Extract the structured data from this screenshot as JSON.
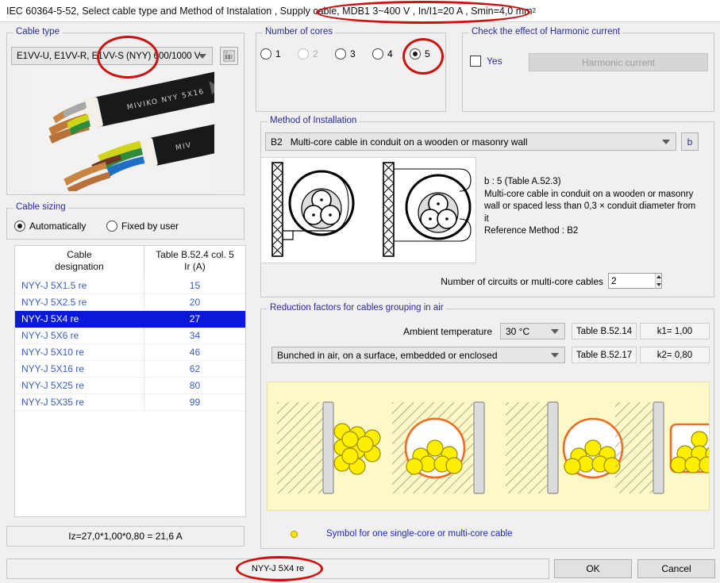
{
  "window": {
    "title_prefix": "IEC 60364-5-52, Select cable type and Method of Instalation , Supply cable, MDB1 3~400 V , In/I1=20 A , Smin=4,0 mm",
    "title_sup": "2"
  },
  "cable_type": {
    "group_label": "Cable type",
    "selected": "E1VV-U, E1VV-R, E1VV-S  (NYY)  600/1000 V",
    "table_icon": "table-icon",
    "photo_text": "MIVIKO NYY 5X16",
    "photo_text_2": "MIV"
  },
  "cable_sizing": {
    "group_label": "Cable sizing",
    "mode_auto": "Automatically",
    "mode_fixed": "Fixed by user",
    "mode_selected": "Automatically",
    "columns": [
      "Cable\ndesignation",
      "Table B.52.4 col. 5\nIr (A)"
    ],
    "col1_line1": "Cable",
    "col1_line2": "designation",
    "col2_line1": "Table B.52.4 col. 5",
    "col2_line2": "Ir (A)",
    "rows": [
      {
        "designation": "NYY-J 5X1.5 re",
        "ir": "15",
        "selected": false
      },
      {
        "designation": "NYY-J 5X2.5 re",
        "ir": "20",
        "selected": false
      },
      {
        "designation": "NYY-J 5X4 re",
        "ir": "27",
        "selected": true
      },
      {
        "designation": "NYY-J 5X6 re",
        "ir": "34",
        "selected": false
      },
      {
        "designation": "NYY-J 5X10 re",
        "ir": "46",
        "selected": false
      },
      {
        "designation": "NYY-J 5X16 re",
        "ir": "62",
        "selected": false
      },
      {
        "designation": "NYY-J 5X25 re",
        "ir": "80",
        "selected": false
      },
      {
        "designation": "NYY-J 5X35 re",
        "ir": "99",
        "selected": false
      }
    ],
    "iz_result": "Iz=27,0*1,00*0,80 = 21,6 A"
  },
  "number_of_cores": {
    "group_label": "Number of cores",
    "options": [
      {
        "label": "1",
        "checked": false,
        "disabled": false
      },
      {
        "label": "2",
        "checked": false,
        "disabled": true
      },
      {
        "label": "3",
        "checked": false,
        "disabled": false
      },
      {
        "label": "4",
        "checked": false,
        "disabled": false
      },
      {
        "label": "5",
        "checked": true,
        "disabled": false
      }
    ]
  },
  "harmonic": {
    "group_label": "Check the effect of Harmonic current",
    "yes_label": "Yes",
    "yes_checked": false,
    "button_label": "Harmonic current",
    "button_enabled": false
  },
  "method_of_installation": {
    "group_label": "Method of Installation",
    "code": "B2",
    "selected": "Multi-core cable in conduit on a wooden or masonry wall",
    "ref_button": "b",
    "description_line1": "b : 5 (Table A.52.3)",
    "description_line2": "Multi-core cable in conduit on a wooden or masonry",
    "description_line3": "wall or spaced less than 0,3 × conduit diameter from",
    "description_line4": "it",
    "description_line5": "Reference Method : B2",
    "circuits_label": "Number of circuits or multi-core cables",
    "circuits_value": "2"
  },
  "reduction_factors": {
    "group_label": "Reduction factors for cables grouping in air",
    "ambient_label": "Ambient temperature",
    "ambient_value": "30 °C",
    "table_1": "Table B.52.14",
    "k1": "k1= 1,00",
    "grouping_value": "Bunched in air, on a surface, embedded or enclosed",
    "table_2": "Table B.52.17",
    "k2": "k2= 0,80",
    "legend": "Symbol for one single-core or multi-core cable"
  },
  "footer": {
    "status_value": "NYY-J 5X4 re",
    "ok_label": "OK",
    "cancel_label": "Cancel"
  },
  "colors": {
    "group_label": "#2a2a9e",
    "table_link": "#3b5fc0",
    "selection": "#0a18d8",
    "annotation": "#cc1111",
    "cable_symbol": "#ffe500"
  }
}
